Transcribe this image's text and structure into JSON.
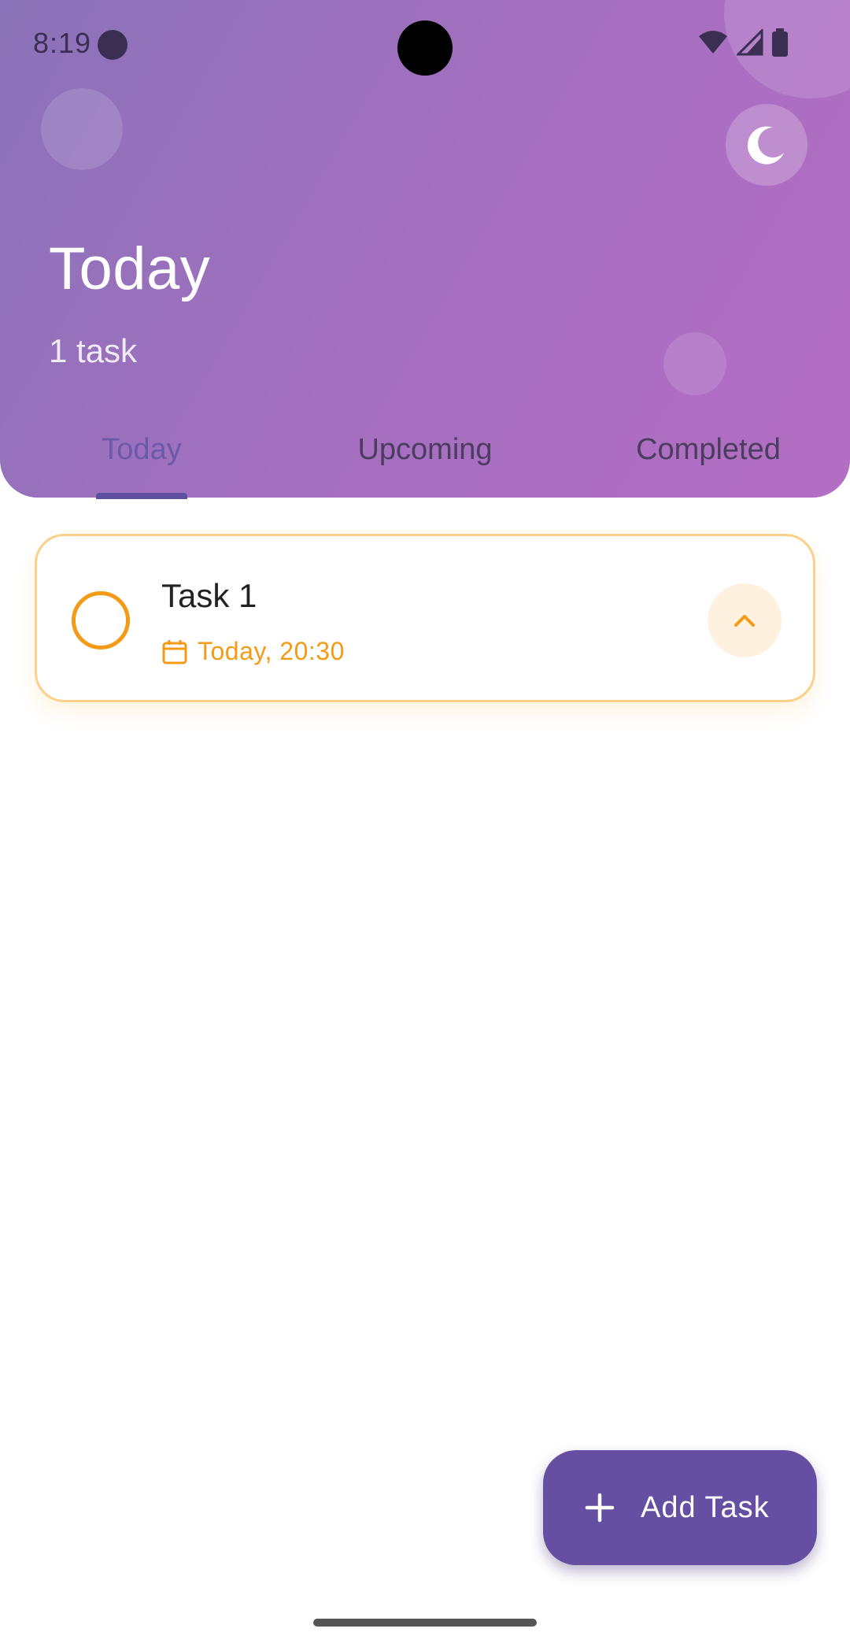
{
  "status_bar": {
    "time": "8:19"
  },
  "header": {
    "title": "Today",
    "subtitle": "1 task",
    "theme_toggle_icon": "moon-icon"
  },
  "tabs": [
    {
      "label": "Today",
      "active": true
    },
    {
      "label": "Upcoming",
      "active": false
    },
    {
      "label": "Completed",
      "active": false
    }
  ],
  "tasks": [
    {
      "title": "Task 1",
      "due": "Today, 20:30",
      "completed": false
    }
  ],
  "fab": {
    "label": "Add Task",
    "icon": "plus-icon"
  },
  "colors": {
    "header_gradient_start": "#8a73b8",
    "header_gradient_end": "#b46ec4",
    "accent": "#654fa2",
    "task_accent": "#f59a17"
  }
}
